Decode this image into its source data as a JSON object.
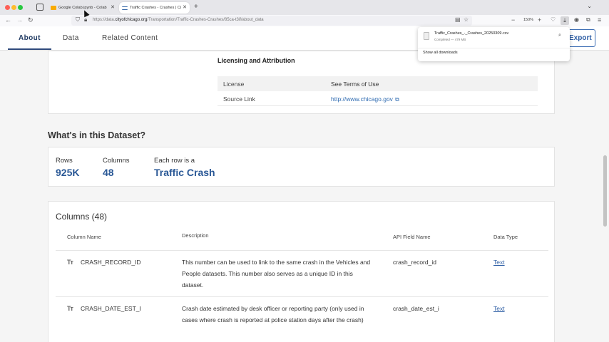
{
  "browser": {
    "tabs": [
      {
        "title": "Google Colab.ipynb - Colab",
        "close": "✕"
      },
      {
        "title": "Traffic Crashes - Crashes | City of Chicago",
        "close": "✕"
      }
    ],
    "new_tab": "+",
    "url_prefix": "https://data.",
    "url_domain": "cityofchicago.org",
    "url_path": "/Transportation/Traffic-Crashes-Crashes/85ca-t3if/about_data",
    "zoom": "150%"
  },
  "site_nav": {
    "about": "About",
    "data": "Data",
    "related": "Related Content",
    "export": "Export"
  },
  "licensing": {
    "title": "Licensing and Attribution",
    "rows": [
      {
        "key": "License",
        "value": "See Terms of Use"
      },
      {
        "key": "Source Link",
        "value": "http://www.chicago.gov"
      }
    ]
  },
  "dataset": {
    "heading": "What's in this Dataset?",
    "rows_label": "Rows",
    "rows_value": "925K",
    "columns_label": "Columns",
    "columns_value": "48",
    "each_label": "Each row is a",
    "each_value": "Traffic Crash"
  },
  "columns": {
    "title": "Columns (48)",
    "headers": {
      "name": "Column Name",
      "description": "Description",
      "api": "API Field Name",
      "type": "Data Type"
    },
    "rows": [
      {
        "type_icon": "Tт",
        "name": "CRASH_RECORD_ID",
        "description": "This number can be used to link to the same crash in the Vehicles and People datasets. This number also serves as a unique ID in this dataset.",
        "api": "crash_record_id",
        "data_type": "Text"
      },
      {
        "type_icon": "Tт",
        "name": "CRASH_DATE_EST_I",
        "description": "Crash date estimated by desk officer or reporting party (only used in cases where crash is reported at police station days after the crash)",
        "api": "crash_date_est_i",
        "data_type": "Text"
      }
    ]
  },
  "downloads": {
    "file_name": "Traffic_Crashes_-_Crashes_20250309.csv",
    "status": "Completed — 479 MB",
    "show_all": "Show all downloads"
  },
  "icons": {
    "back": "back-arrow-icon",
    "forward": "forward-arrow-icon",
    "reload": "reload-icon",
    "external": "external-link-icon",
    "folder": "folder-icon"
  }
}
